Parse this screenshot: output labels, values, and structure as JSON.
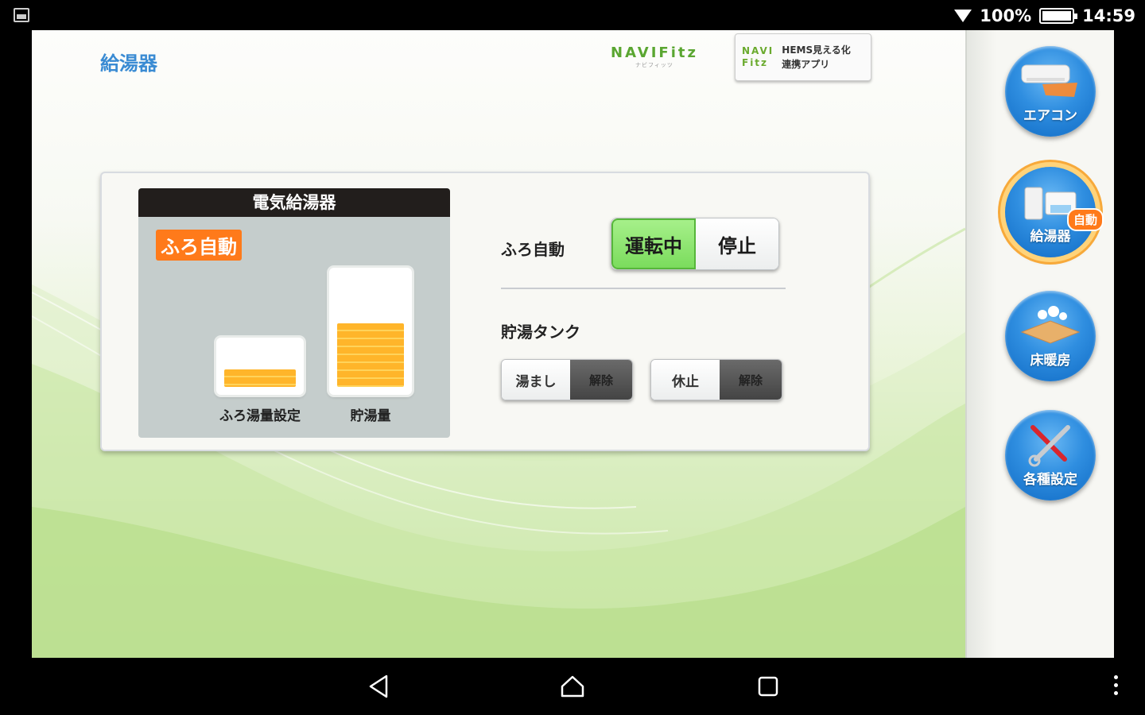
{
  "status_bar": {
    "battery": "100%",
    "time": "14:59"
  },
  "header": {
    "title": "給湯器",
    "logo": "NAVIFitz",
    "logo_sub": "ナビフィッツ",
    "hems_logo_line1": "NAVI",
    "hems_logo_line2": "Fitz",
    "hems_text_line1": "HEMS見える化",
    "hems_text_line2": "連携アプリ"
  },
  "device": {
    "title": "電気給湯器",
    "mode_badge": "ふろ自動",
    "bath_tank_label": "ふろ湯量設定",
    "storage_tank_label": "貯湯量",
    "bath_level": 0.3,
    "storage_level": 0.5
  },
  "controls": {
    "bath_auto_label": "ふろ自動",
    "bath_auto_on": "運転中",
    "bath_auto_off": "停止",
    "tank_label": "貯湯タンク",
    "yumashi_label": "湯まし",
    "yumashi_release": "解除",
    "kyushi_label": "休止",
    "kyushi_release": "解除"
  },
  "sidebar": {
    "items": [
      {
        "label": "エアコン"
      },
      {
        "label": "給湯器",
        "badge": "自動"
      },
      {
        "label": "床暖房"
      },
      {
        "label": "各種設定"
      }
    ]
  },
  "colors": {
    "accent_blue": "#3a8bd3",
    "auto_orange": "#ff7a1a",
    "running_green": "#7bdc5d",
    "water_yellow": "#ffb52a"
  }
}
